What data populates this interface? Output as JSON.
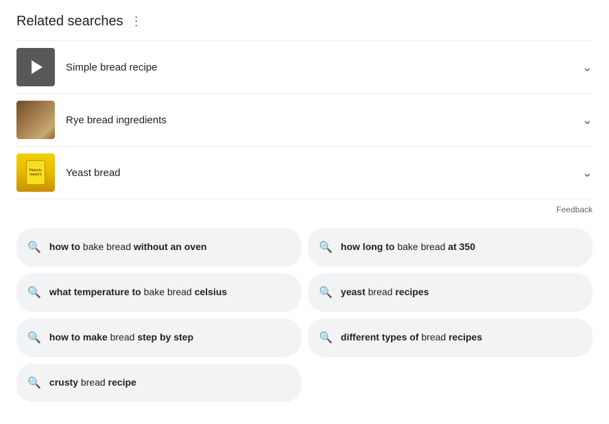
{
  "header": {
    "title": "Related searches",
    "dots_label": "⋮"
  },
  "related_items": [
    {
      "label": "Simple bread recipe",
      "thumb_type": "video"
    },
    {
      "label": "Rye bread ingredients",
      "thumb_type": "rye"
    },
    {
      "label": "Yeast bread",
      "thumb_type": "yeast"
    }
  ],
  "feedback_label": "Feedback",
  "chips": [
    {
      "id": "chip1",
      "html_parts": [
        {
          "bold": true,
          "text": "how to"
        },
        {
          "bold": false,
          "text": " bake bread "
        },
        {
          "bold": true,
          "text": "without an oven"
        }
      ],
      "full_text": "how to bake bread without an oven"
    },
    {
      "id": "chip2",
      "html_parts": [
        {
          "bold": true,
          "text": "how long to"
        },
        {
          "bold": false,
          "text": " bake bread "
        },
        {
          "bold": true,
          "text": "at 350"
        }
      ],
      "full_text": "how long to bake bread at 350"
    },
    {
      "id": "chip3",
      "html_parts": [
        {
          "bold": true,
          "text": "what temperature to"
        },
        {
          "bold": false,
          "text": " bake bread "
        },
        {
          "bold": true,
          "text": "celsius"
        }
      ],
      "full_text": "what temperature to bake bread celsius"
    },
    {
      "id": "chip4",
      "html_parts": [
        {
          "bold": true,
          "text": "yeast"
        },
        {
          "bold": false,
          "text": " bread "
        },
        {
          "bold": true,
          "text": "recipes"
        }
      ],
      "full_text": "yeast bread recipes"
    },
    {
      "id": "chip5",
      "html_parts": [
        {
          "bold": true,
          "text": "how to make"
        },
        {
          "bold": false,
          "text": " bread "
        },
        {
          "bold": true,
          "text": "step by step"
        }
      ],
      "full_text": "how to make bread step by step"
    },
    {
      "id": "chip6",
      "html_parts": [
        {
          "bold": true,
          "text": "different types of"
        },
        {
          "bold": false,
          "text": " bread "
        },
        {
          "bold": true,
          "text": "recipes"
        }
      ],
      "full_text": "different types of bread recipes"
    },
    {
      "id": "chip7",
      "html_parts": [
        {
          "bold": true,
          "text": "crusty"
        },
        {
          "bold": false,
          "text": " bread "
        },
        {
          "bold": true,
          "text": "recipe"
        }
      ],
      "full_text": "crusty bread recipe"
    }
  ]
}
